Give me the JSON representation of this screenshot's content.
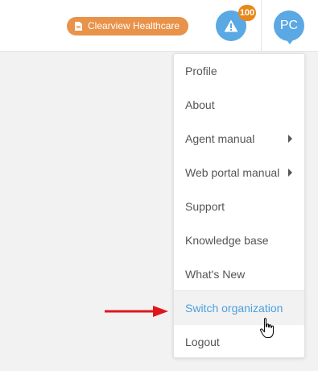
{
  "header": {
    "organization": "Clearview Healthcare",
    "alert_count": "100",
    "avatar_initials": "PC"
  },
  "menu": {
    "items": [
      {
        "label": "Profile"
      },
      {
        "label": "About"
      },
      {
        "label": "Agent manual"
      },
      {
        "label": "Web portal manual"
      },
      {
        "label": "Support"
      },
      {
        "label": "Knowledge base"
      },
      {
        "label": "What's New"
      },
      {
        "label": "Switch organization"
      },
      {
        "label": "Logout"
      }
    ]
  },
  "colors": {
    "accent_blue": "#5aa8e4",
    "org_badge": "#e8924a",
    "alert_badge": "#e8881a",
    "annotation_arrow": "#e0161b"
  },
  "icons": [
    "document-icon",
    "warning-icon",
    "submenu-caret-icon",
    "hand-pointer-icon"
  ]
}
